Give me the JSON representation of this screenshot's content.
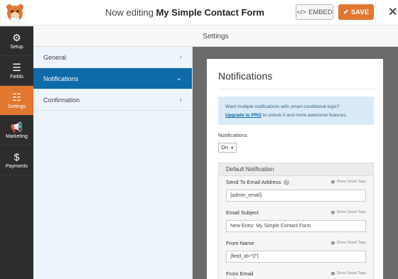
{
  "header": {
    "editing_prefix": "Now editing",
    "form_name": "My Simple Contact Form",
    "embed_label": "EMBED",
    "embed_icon": "code-icon",
    "save_label": "SAVE",
    "save_icon": "checkmark-icon",
    "close_icon": "close-icon"
  },
  "sidebar": {
    "items": [
      {
        "label": "Setup",
        "icon": "gear-icon"
      },
      {
        "label": "Fields",
        "icon": "list-icon"
      },
      {
        "label": "Settings",
        "icon": "sliders-icon"
      },
      {
        "label": "Marketing",
        "icon": "megaphone-icon"
      },
      {
        "label": "Payments",
        "icon": "dollar-icon"
      }
    ],
    "active": "Settings"
  },
  "settings": {
    "title": "Settings",
    "nav": [
      {
        "label": "General",
        "icon": "chevron-right-icon"
      },
      {
        "label": "Notifications",
        "icon": "chevron-down-icon"
      },
      {
        "label": "Confirmation",
        "icon": "chevron-right-icon"
      }
    ],
    "active": "Notifications"
  },
  "panel": {
    "title": "Notifications",
    "info_text": "Want multiple notifications with smart conditional logic?",
    "info_link": "Upgrade to PRO",
    "info_suffix": " to unlock it and more awesome features.",
    "notifications_label": "Notifications",
    "notifications_value": "On",
    "default_notification_title": "Default Notification",
    "smart_tags_label": "Show Smart Tags",
    "fields": [
      {
        "label": "Send To Email Address",
        "value": "{admin_email}"
      },
      {
        "label": "Email Subject",
        "value": "New Entry: My Simple Contact Form"
      },
      {
        "label": "From Name",
        "value": "{field_id=\"0\"}"
      },
      {
        "label": "From Email",
        "value": ""
      }
    ]
  },
  "colors": {
    "accent": "#e27730",
    "active_nav": "#0e6aa8",
    "sidebar": "#2d2d2d",
    "info_bg": "#d9eaf6"
  }
}
